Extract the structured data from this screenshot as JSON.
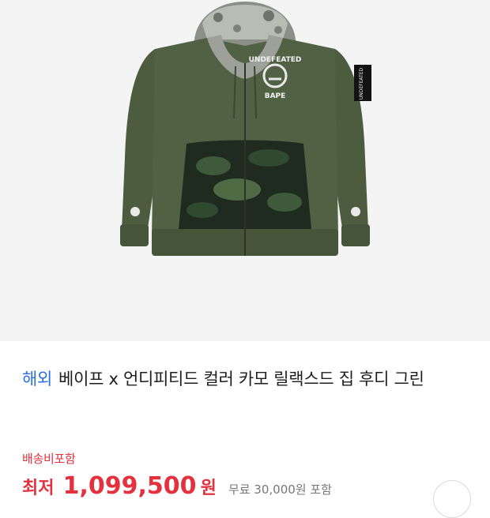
{
  "product": {
    "image_alt": "Green full-zip hoodie with camo kangaroo pocket and camo hood",
    "chest_logo_top": "UNDEFEATED",
    "chest_logo_bottom": "BAPE",
    "sleeve_patch": "UNDEFEATED",
    "tag": "해외",
    "title": "베이프 x 언디피티드 컬러 카모 릴랙스드 집 후디 그린",
    "shipping": "배송비포함",
    "price_label": "최저",
    "price": "1,099,500",
    "price_unit": "원",
    "price_sub": "무료 30,000원 포함"
  },
  "colors": {
    "hoodie": "#4d5c3f",
    "accent_blue": "#2a6ee6",
    "accent_red": "#e4313d"
  }
}
